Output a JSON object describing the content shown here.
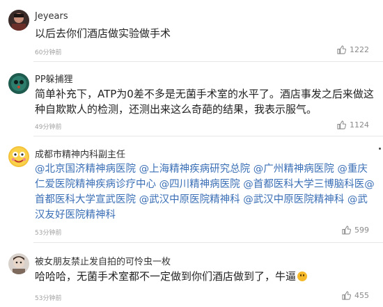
{
  "comments": [
    {
      "user": "Jeyears",
      "text": "以后去你们酒店做实验做手术",
      "time": "60分钟前",
      "likes": "1222"
    },
    {
      "user": "PP躲捕狸",
      "text": "简单补充下，ATP为0差不多是无菌手术室的水平了。酒店事发之后来做这种自欺欺人的检测，还测出来这么奇葩的结果，我表示服气。",
      "time": "49分钟前",
      "likes": "1124"
    },
    {
      "user": "成都市精神内科副主任",
      "text": "@北京国济精神病医院 @上海精神疾病研究总院 @广州精神病医院 @重庆仁爱医院精神疾病诊疗中心 @四川精神病医院 @首都医科大学三博脑科医@首都医科大学宣武医院 @武汉中原医院精神科 @武汉中原医院精神科 @武汉友好医院精神科",
      "time": "53分钟前",
      "likes": "599"
    },
    {
      "user": "被女朋友禁止发自拍的可怜虫一枚",
      "text": "哈哈哈，无菌手术室都不一定做到你们酒店做到了，牛逼",
      "time": "53分钟前",
      "likes": "455"
    }
  ],
  "icons": {
    "like": "thumbs-up-icon",
    "emoji": "smile-emoji-icon"
  },
  "colors": {
    "mention": "#3b6fb6",
    "meta": "#a0a0a0",
    "divider": "#e6e6e6"
  }
}
